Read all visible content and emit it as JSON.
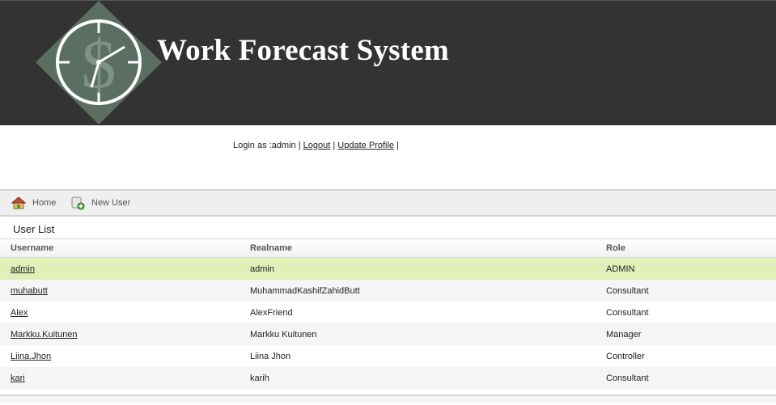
{
  "header": {
    "title": "Work Forecast System",
    "logo_icon": "clock-dollar-logo",
    "background_color": "#333333"
  },
  "login": {
    "prefix": "Login as :admin",
    "sep1": "|",
    "logout": "Logout",
    "sep2": "|",
    "update_profile": "Update Profile",
    "sep3": "|"
  },
  "toolbar": {
    "home_label": "Home",
    "home_icon": "home-icon",
    "new_user_label": "New User",
    "new_user_icon": "add-user-icon"
  },
  "user_list": {
    "title": "User List",
    "columns": [
      "Username",
      "Realname",
      "Role"
    ],
    "rows": [
      {
        "username": "admin",
        "realname": "admin",
        "role": "ADMIN"
      },
      {
        "username": "muhabutt",
        "realname": "MuhammadKashifZahidButt",
        "role": "Consultant"
      },
      {
        "username": "Alex",
        "realname": "AlexFriend",
        "role": "Consultant"
      },
      {
        "username": "Markku.Kuitunen",
        "realname": "Markku Kuitunen",
        "role": "Manager"
      },
      {
        "username": "Liina.Jhon",
        "realname": "Liina Jhon",
        "role": "Controller"
      },
      {
        "username": "kari",
        "realname": "karih",
        "role": "Consultant"
      }
    ],
    "selected_row_color": "#e0f0b8"
  }
}
